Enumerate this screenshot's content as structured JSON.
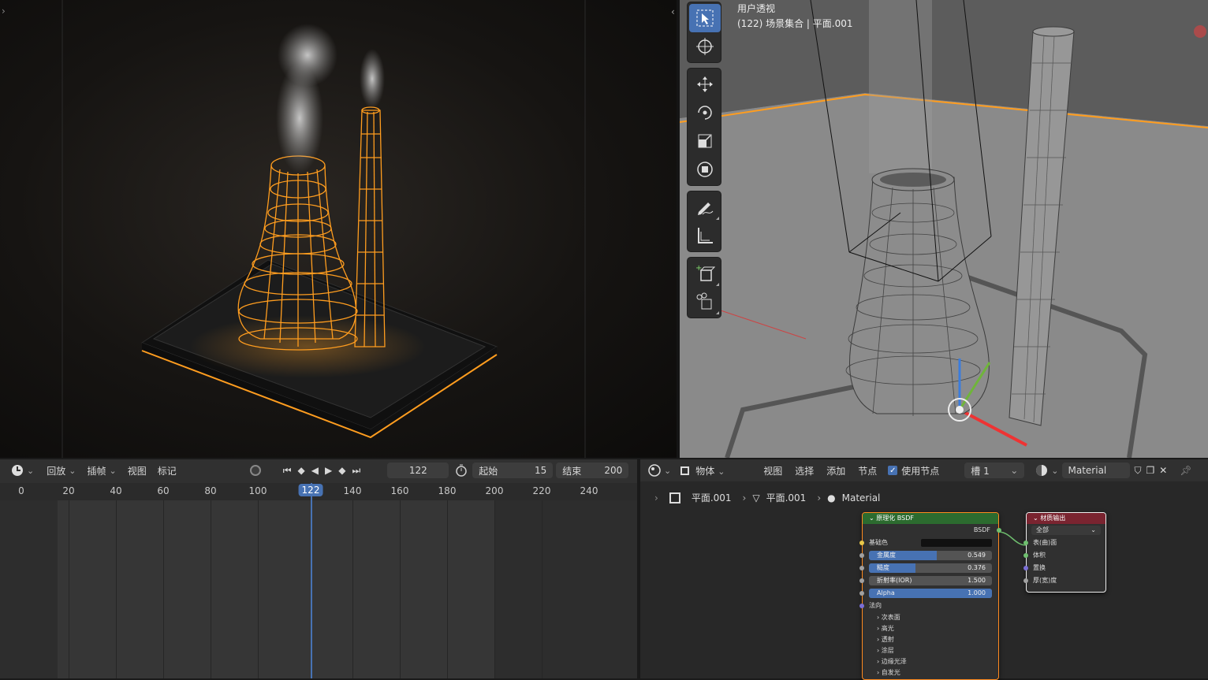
{
  "viewport": {
    "title_line1": "用户透视",
    "title_line2": "(122) 场景集合 | 平面.001"
  },
  "timeline": {
    "menus": [
      "回放",
      "插帧",
      "视图",
      "标记"
    ],
    "current_frame": "122",
    "start_label": "起始",
    "start_value": "15",
    "end_label": "结束",
    "end_value": "200",
    "ticks": [
      "0",
      "20",
      "40",
      "60",
      "80",
      "100",
      "140",
      "160",
      "180",
      "200",
      "220",
      "240"
    ],
    "ticks_frames": [
      0,
      20,
      40,
      60,
      80,
      100,
      140,
      160,
      180,
      200,
      220,
      240
    ],
    "playhead_frame": 122
  },
  "node_editor": {
    "object_mode": "物体",
    "menus": [
      "视图",
      "选择",
      "添加",
      "节点"
    ],
    "use_nodes_label": "使用节点",
    "slot": "槽 1",
    "material_name": "Material",
    "breadcrumb": [
      "平面.001",
      "平面.001",
      "Material"
    ],
    "bsdf_node": {
      "title": "原理化 BSDF",
      "output": "BSDF",
      "base_color_label": "基础色",
      "metallic_label": "金属度",
      "metallic_value": "0.549",
      "metallic_fraction": 0.549,
      "roughness_label": "糙度",
      "roughness_value": "0.376",
      "roughness_fraction": 0.376,
      "ior_label": "折射率(IOR)",
      "ior_value": "1.500",
      "alpha_label": "Alpha",
      "alpha_value": "1.000",
      "alpha_fraction": 1.0,
      "normal_label": "法向",
      "panels": [
        "次表面",
        "高光",
        "透射",
        "涂层",
        "边缘光泽",
        "自发光"
      ]
    },
    "output_node": {
      "title": "材质输出",
      "target": "全部",
      "inputs": [
        "表(曲)面",
        "体积",
        "置换",
        "厚(宽)度"
      ]
    }
  },
  "colors": {
    "accent_blue": "#4772b3",
    "wire_orange": "#ff9d1f",
    "bsdf_header": "#2c6b2f",
    "output_header": "#7a2430"
  }
}
